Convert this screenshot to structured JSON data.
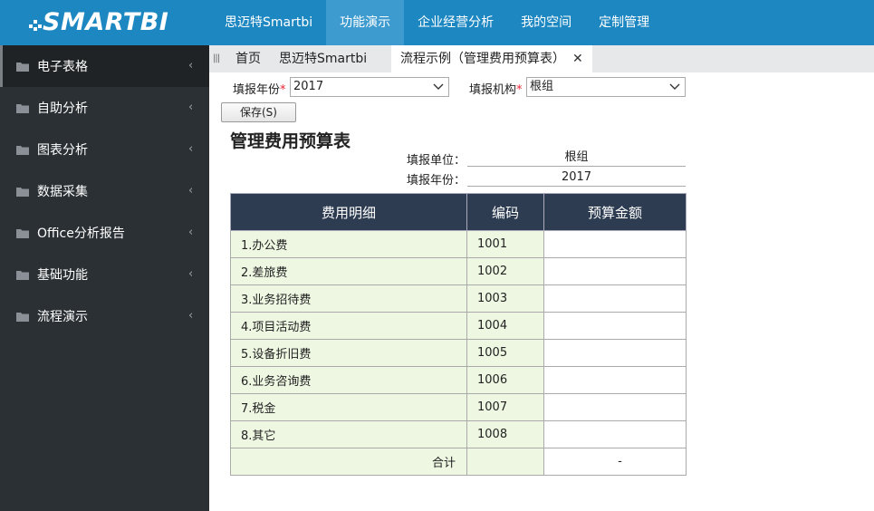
{
  "header": {
    "logo_text": "SMARTBI",
    "nav": [
      "思迈特Smartbi",
      "功能演示",
      "企业经营分析",
      "我的空间",
      "定制管理"
    ],
    "active_nav_index": 1
  },
  "sidebar": {
    "items": [
      {
        "label": "电子表格",
        "icon": "folder-icon"
      },
      {
        "label": "自助分析",
        "icon": "folder-icon"
      },
      {
        "label": "图表分析",
        "icon": "folder-icon"
      },
      {
        "label": "数据采集",
        "icon": "folder-icon"
      },
      {
        "label": "Office分析报告",
        "icon": "folder-icon"
      },
      {
        "label": "基础功能",
        "icon": "folder-icon"
      },
      {
        "label": "流程演示",
        "icon": "folder-icon"
      }
    ],
    "active_index": 0
  },
  "tabs": {
    "handle": "|||",
    "home": "首页",
    "smartbi": "思迈特Smartbi",
    "active": "流程示例（管理费用预算表）",
    "close": "✕"
  },
  "form": {
    "year_label": "填报年份",
    "year_value": "2017",
    "org_label": "填报机构",
    "org_value": "根组",
    "required_mark": "*",
    "save_button": "保存(S)"
  },
  "report": {
    "title": "管理费用预算表",
    "unit_label": "填报单位：",
    "unit_value": "根组",
    "year_label": "填报年份：",
    "year_value": "2017",
    "columns": [
      "费用明细",
      "编码",
      "预算金额"
    ],
    "rows": [
      {
        "item": "1.办公费",
        "code": "1001",
        "amount": ""
      },
      {
        "item": "2.差旅费",
        "code": "1002",
        "amount": ""
      },
      {
        "item": "3.业务招待费",
        "code": "1003",
        "amount": ""
      },
      {
        "item": "4.项目活动费",
        "code": "1004",
        "amount": ""
      },
      {
        "item": "5.设备折旧费",
        "code": "1005",
        "amount": ""
      },
      {
        "item": "6.业务咨询费",
        "code": "1006",
        "amount": ""
      },
      {
        "item": "7.税金",
        "code": "1007",
        "amount": ""
      },
      {
        "item": "8.其它",
        "code": "1008",
        "amount": ""
      }
    ],
    "total_label": "合计",
    "total_value": "-"
  },
  "colors": {
    "topbar": "#1d87c2",
    "nav_active": "#3d9bcf",
    "sidebar": "#2b3034",
    "table_header": "#2e3c52",
    "label_cell": "#eef7e2"
  }
}
